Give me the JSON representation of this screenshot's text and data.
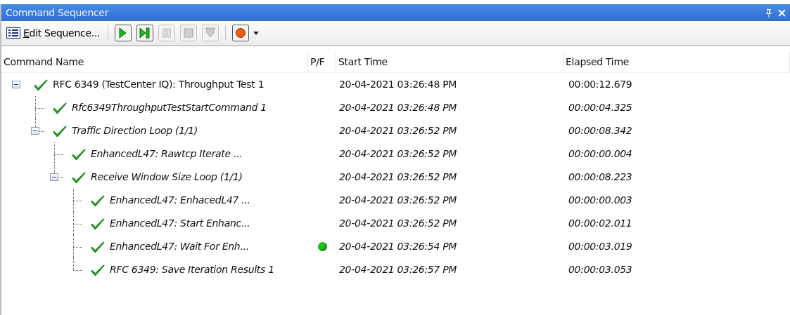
{
  "window": {
    "title": "Command Sequencer"
  },
  "toolbar": {
    "edit_button": {
      "label": "Edit Sequence..."
    },
    "buttons": [
      {
        "kind": "run",
        "disabled": false
      },
      {
        "kind": "step",
        "disabled": false
      },
      {
        "kind": "pause",
        "disabled": true
      },
      {
        "kind": "stop",
        "disabled": true
      },
      {
        "kind": "skip",
        "disabled": true
      },
      {
        "kind": "record",
        "disabled": false
      }
    ]
  },
  "table": {
    "columns": [
      "Command Name",
      "P/F",
      "Start Time",
      "Elapsed Time"
    ],
    "rows": [
      {
        "name": "RFC 6349 (TestCenter IQ): Throughput Test 1",
        "passed": true,
        "pf_dot": false,
        "start_time": "20-04-2021 03:26:48 PM",
        "elapsed_time": "00:00:12.679",
        "expanded": true,
        "children": [
          {
            "name": "Rfc6349ThroughputTestStartCommand 1",
            "passed": true,
            "pf_dot": false,
            "start_time": "20-04-2021 03:26:48 PM",
            "elapsed_time": "00:00:04.325"
          },
          {
            "name": "Traffic Direction Loop (1/1)",
            "passed": true,
            "pf_dot": false,
            "start_time": "20-04-2021 03:26:52 PM",
            "elapsed_time": "00:00:08.342",
            "expanded": true,
            "children": [
              {
                "name": "EnhancedL47: Rawtcp Iterate ...",
                "passed": true,
                "pf_dot": false,
                "start_time": "20-04-2021 03:26:52 PM",
                "elapsed_time": "00:00:00.004"
              },
              {
                "name": "Receive Window Size Loop (1/1)",
                "passed": true,
                "pf_dot": false,
                "start_time": "20-04-2021 03:26:52 PM",
                "elapsed_time": "00:00:08.223",
                "expanded": true,
                "children": [
                  {
                    "name": "EnhancedL47: EnhacedL47 ...",
                    "passed": true,
                    "pf_dot": false,
                    "start_time": "20-04-2021 03:26:52 PM",
                    "elapsed_time": "00:00:00.003"
                  },
                  {
                    "name": "EnhancedL47: Start Enhanc...",
                    "passed": true,
                    "pf_dot": false,
                    "start_time": "20-04-2021 03:26:52 PM",
                    "elapsed_time": "00:00:02.011"
                  },
                  {
                    "name": "EnhancedL47: Wait For Enh...",
                    "passed": true,
                    "pf_dot": true,
                    "start_time": "20-04-2021 03:26:54 PM",
                    "elapsed_time": "00:00:03.019"
                  },
                  {
                    "name": "RFC 6349: Save Iteration Results 1",
                    "passed": true,
                    "pf_dot": false,
                    "start_time": "20-04-2021 03:26:57 PM",
                    "elapsed_time": "00:00:03.053"
                  }
                ]
              }
            ]
          }
        ]
      }
    ]
  }
}
